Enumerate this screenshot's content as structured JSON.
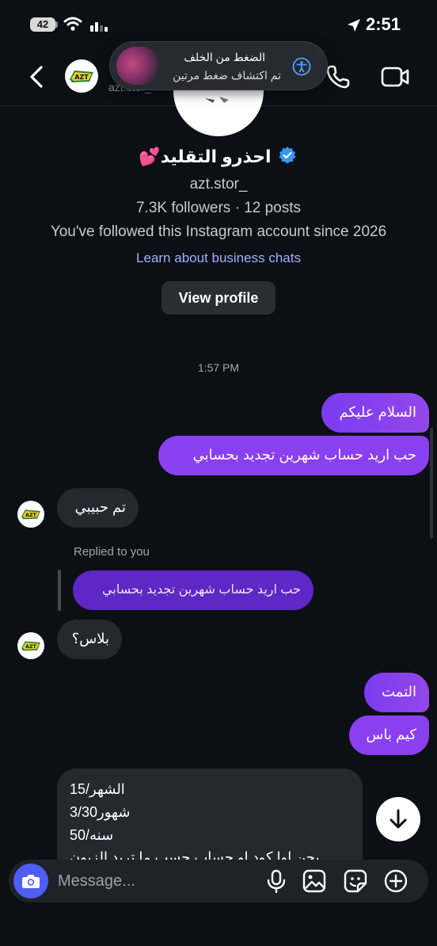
{
  "status_bar": {
    "battery": "42",
    "time": "2:51"
  },
  "toast": {
    "line1": "الضغط من الخلف",
    "line2": "تم اكتشاف ضغط مرتين"
  },
  "header": {
    "username": "azt.stor_"
  },
  "profile": {
    "name": "احذرو التقليد",
    "emoji": "💕",
    "handle": "azt.stor_",
    "stats": "7.3K followers · 12 posts",
    "since": "You've followed this Instagram account since 2026",
    "business_link": "Learn about business chats",
    "view_profile": "View profile"
  },
  "conversation": {
    "timestamp": "1:57 PM",
    "messages": [
      {
        "from": "me",
        "text": "السلام عليكم"
      },
      {
        "from": "me",
        "text": "حب اريد حساب شهرين تجديد بحسابي"
      },
      {
        "from": "them",
        "text": "تم حبيبي"
      },
      {
        "replied_label": "Replied to you",
        "quoted": "حب اريد حساب شهرين تجديد بحسابي"
      },
      {
        "from": "them",
        "text": "بلاس؟"
      },
      {
        "from": "me",
        "text": "التمت"
      },
      {
        "from": "me",
        "text": "كيم باس"
      },
      {
        "from": "them",
        "lines": [
          "الشهر/15",
          "شهور3/30",
          "سنه/50",
          "يحن اوا كود او حساب حسب ما تريد الزبون"
        ]
      }
    ]
  },
  "composer": {
    "placeholder": "Message..."
  },
  "colors": {
    "accent_purple": "#8a3ff0",
    "camera_blue": "#4e5ef2",
    "verified_blue": "#3797f0",
    "link": "#9fb0ff"
  }
}
